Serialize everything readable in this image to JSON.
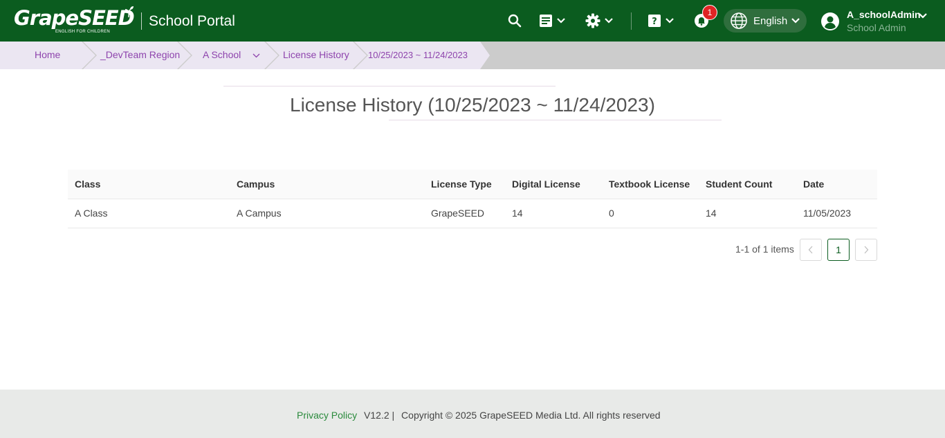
{
  "header": {
    "logo_text": "GrapeSEED",
    "logo_tagline": "ENGLISH FOR CHILDREN",
    "portal_title": "School Portal",
    "notification_count": "1",
    "language": "English",
    "user_name": "A_schoolAdmin",
    "user_role": "School Admin",
    "brand_color": "#0b5c1f"
  },
  "breadcrumb": [
    "Home",
    "_DevTeam Region",
    "A School",
    "License History",
    "10/25/2023 ~ 11/24/2023"
  ],
  "page": {
    "title": "License History (10/25/2023 ~ 11/24/2023)"
  },
  "table": {
    "headers": [
      "Class",
      "Campus",
      "License Type",
      "Digital License",
      "Textbook License",
      "Student Count",
      "Date"
    ],
    "rows": [
      [
        "A Class",
        "A Campus",
        "GrapeSEED",
        "14",
        "0",
        "14",
        "11/05/2023"
      ]
    ]
  },
  "pagination": {
    "info": "1-1 of 1 items",
    "prev": "<",
    "current": "1",
    "next": ">"
  },
  "footer": {
    "privacy": "Privacy Policy",
    "version": "V12.2 |",
    "copyright": "Copyright © 2025 GrapeSEED Media Ltd. All rights reserved"
  }
}
